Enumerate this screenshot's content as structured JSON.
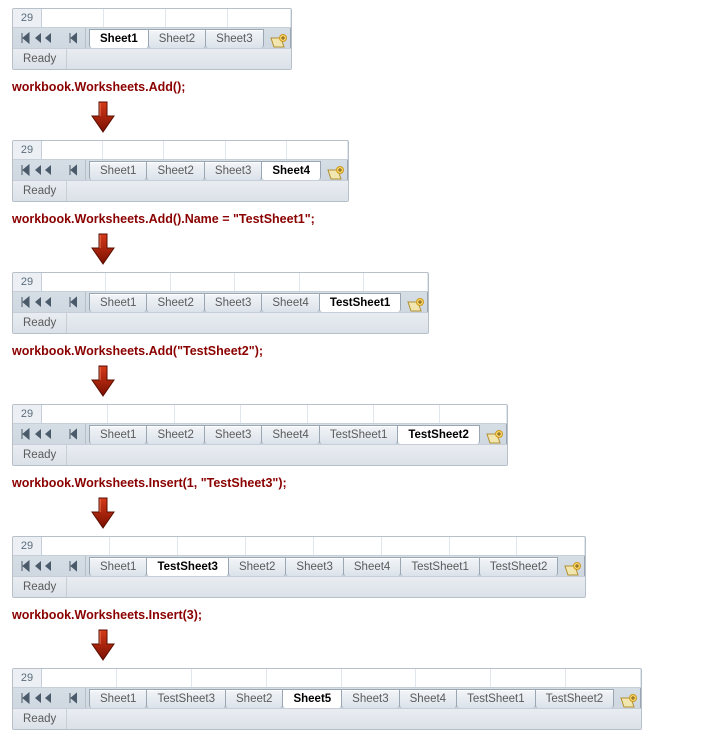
{
  "rownum": "29",
  "status": "Ready",
  "panels": [
    {
      "tabs": [
        "Sheet1",
        "Sheet2",
        "Sheet3"
      ],
      "active": 0,
      "cells": 4
    },
    {
      "tabs": [
        "Sheet1",
        "Sheet2",
        "Sheet3",
        "Sheet4"
      ],
      "active": 3,
      "cells": 5
    },
    {
      "tabs": [
        "Sheet1",
        "Sheet2",
        "Sheet3",
        "Sheet4",
        "TestSheet1"
      ],
      "active": 4,
      "cells": 6
    },
    {
      "tabs": [
        "Sheet1",
        "Sheet2",
        "Sheet3",
        "Sheet4",
        "TestSheet1",
        "TestSheet2"
      ],
      "active": 5,
      "cells": 7
    },
    {
      "tabs": [
        "Sheet1",
        "TestSheet3",
        "Sheet2",
        "Sheet3",
        "Sheet4",
        "TestSheet1",
        "TestSheet2"
      ],
      "active": 1,
      "cells": 8
    },
    {
      "tabs": [
        "Sheet1",
        "TestSheet3",
        "Sheet2",
        "Sheet5",
        "Sheet3",
        "Sheet4",
        "TestSheet1",
        "TestSheet2"
      ],
      "active": 3,
      "cells": 8
    }
  ],
  "captions": [
    "workbook.Worksheets.Add();",
    "workbook.Worksheets.Add().Name = \"TestSheet1\";",
    "workbook.Worksheets.Add(\"TestSheet2\");",
    "workbook.Worksheets.Insert(1, \"TestSheet3\");",
    "workbook.Worksheets.Insert(3);"
  ]
}
